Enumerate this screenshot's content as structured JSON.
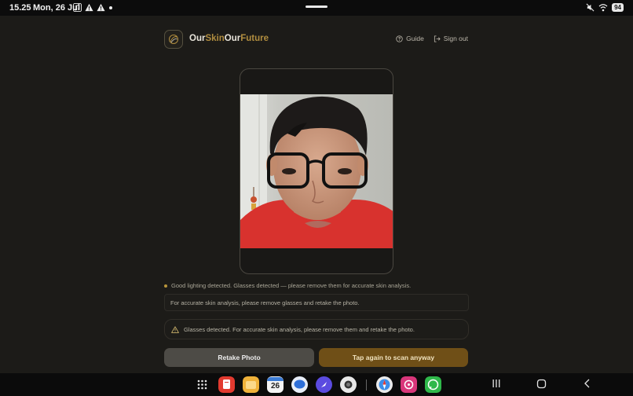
{
  "status_bar": {
    "time": "15.25",
    "date": "Mon, 26 Jul",
    "battery": "94"
  },
  "header": {
    "brand_part1": "Our",
    "brand_part2": "Skin",
    "brand_part3": "Our",
    "brand_part4": "Future",
    "guide_label": "Guide",
    "signout_label": "Sign out"
  },
  "scan": {
    "status_text": "Good lighting detected. Glasses detected — please remove them for accurate skin analysis.",
    "info_text": "For accurate skin analysis, please remove glasses and retake the photo.",
    "warning_text": "Glasses detected. For accurate skin analysis, please remove them and retake the photo.",
    "retake_label": "Retake Photo",
    "scan_label": "Tap again to scan anyway"
  },
  "dock": {
    "calendar_day": "26"
  },
  "colors": {
    "accent": "#b08d3f",
    "scan_button": "#6f4f17",
    "retake_button": "#4d4b46",
    "background": "#1c1b18"
  }
}
